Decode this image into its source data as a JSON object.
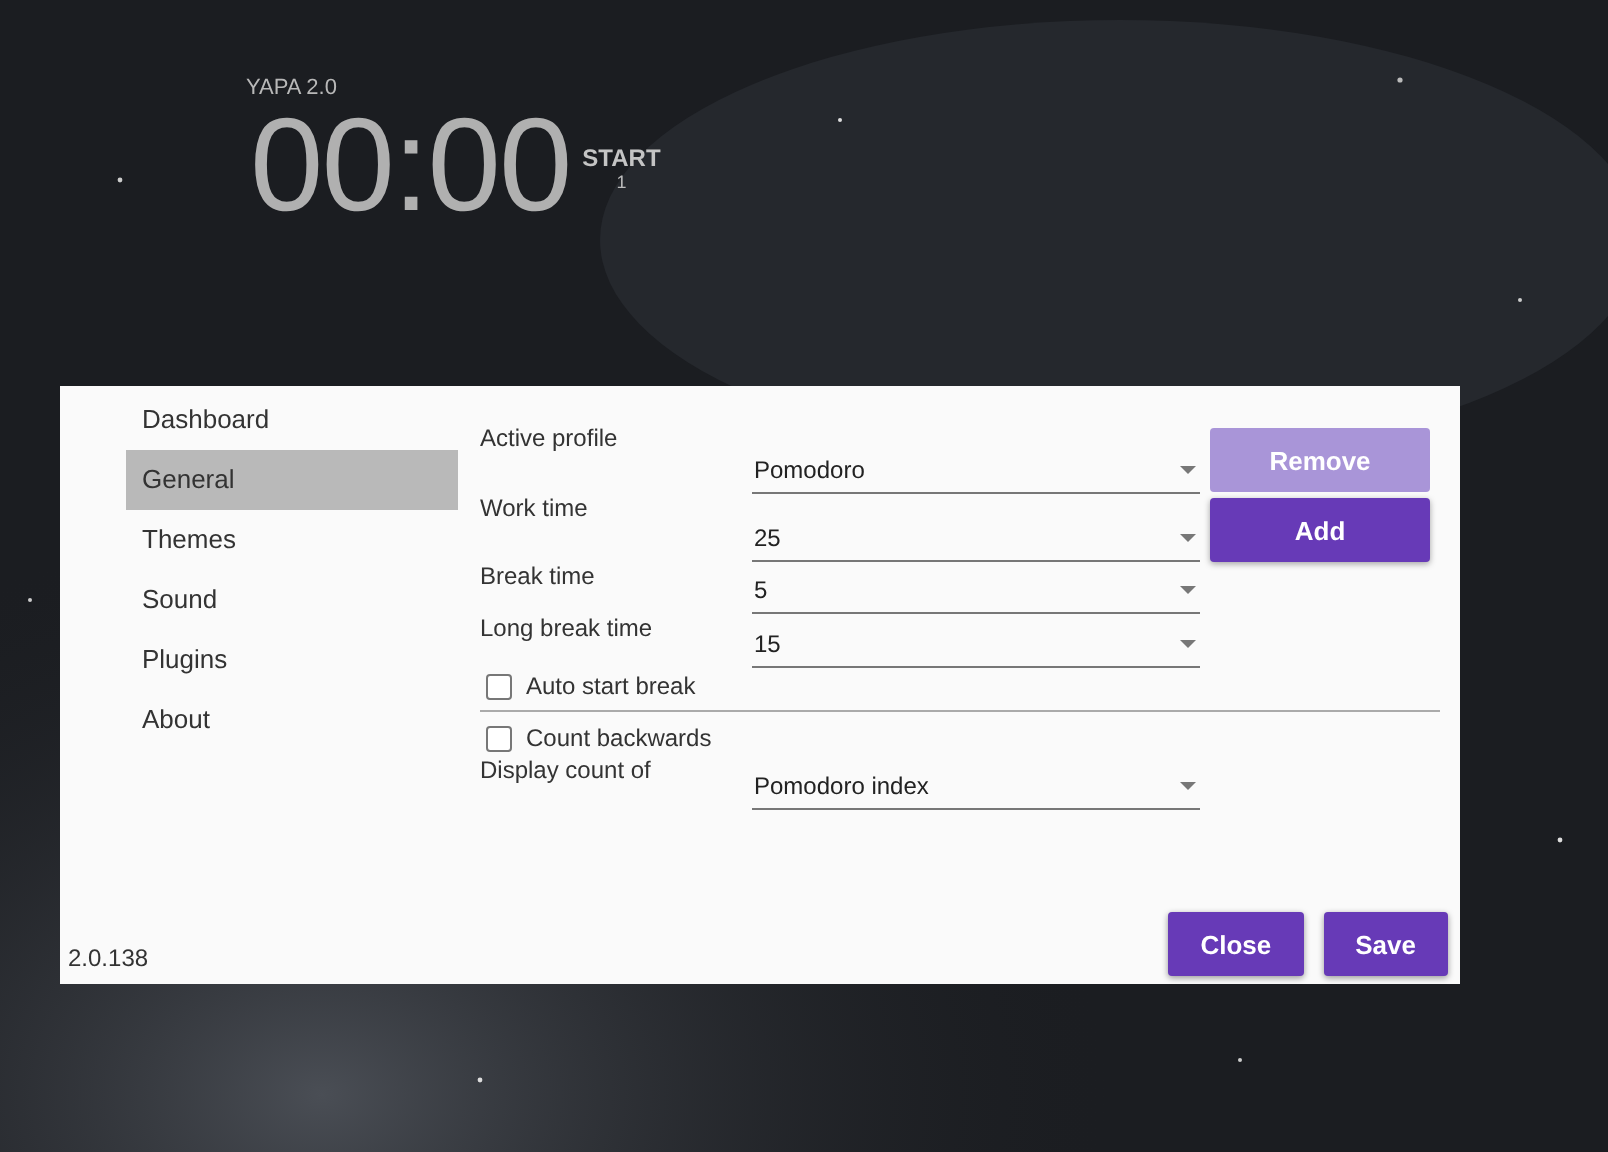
{
  "app": {
    "name": "YAPA 2.0",
    "timer": "00:00",
    "start": "START",
    "count": "1"
  },
  "sidebar": {
    "items": [
      {
        "label": "Dashboard",
        "selected": false
      },
      {
        "label": "General",
        "selected": true
      },
      {
        "label": "Themes",
        "selected": false
      },
      {
        "label": "Sound",
        "selected": false
      },
      {
        "label": "Plugins",
        "selected": false
      },
      {
        "label": "About",
        "selected": false
      }
    ]
  },
  "settings": {
    "groups": [
      [
        {
          "kind": "select",
          "label": "Active profile",
          "value": "Pomodoro"
        },
        {
          "kind": "select",
          "label": "Work time",
          "value": "25"
        },
        {
          "kind": "select",
          "label": "Break time",
          "value": "5"
        },
        {
          "kind": "select",
          "label": "Long break time",
          "value": "15"
        },
        {
          "kind": "checkbox",
          "label": "Auto start break",
          "checked": false
        }
      ],
      [
        {
          "kind": "checkbox",
          "label": "Count backwards",
          "checked": false
        },
        {
          "kind": "select",
          "label": "Display count of",
          "value": "Pomodoro index"
        }
      ]
    ],
    "profile_buttons": [
      {
        "label": "Remove",
        "disabled": true
      },
      {
        "label": "Add",
        "disabled": false
      }
    ]
  },
  "footer": {
    "version": "2.0.138",
    "buttons": [
      "Close",
      "Save"
    ]
  }
}
